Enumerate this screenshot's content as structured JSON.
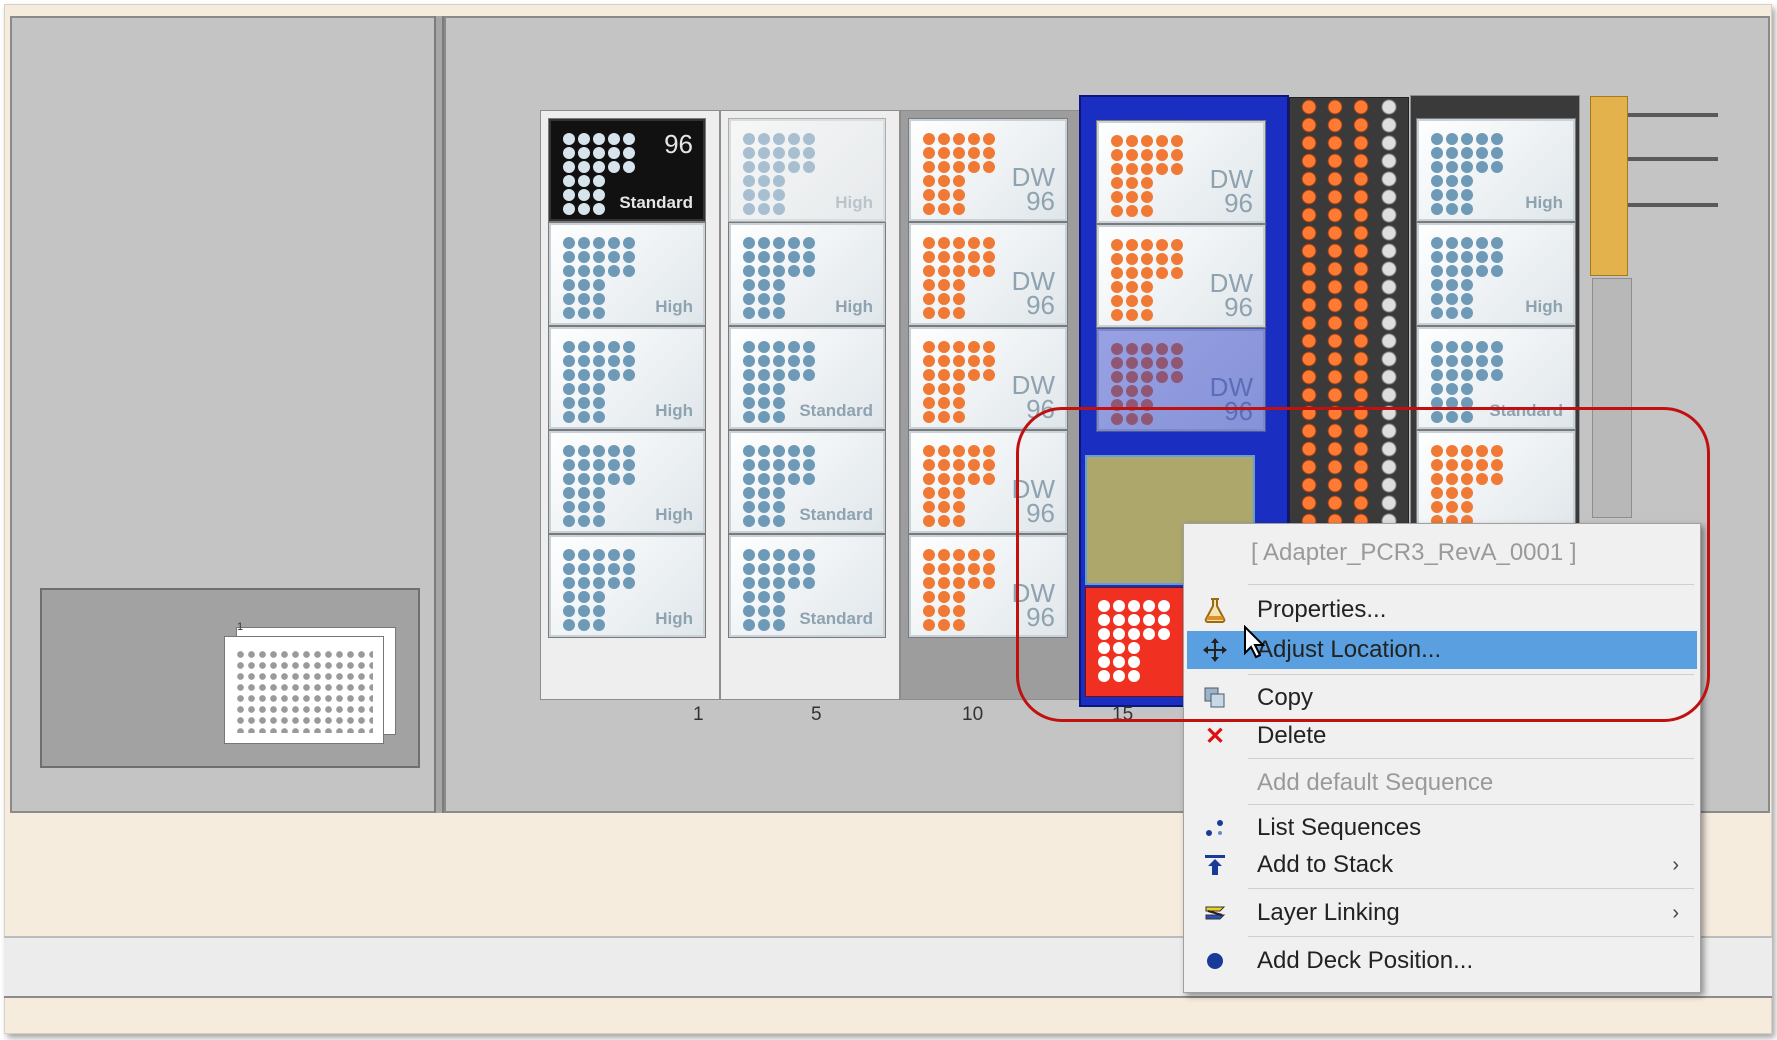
{
  "menu": {
    "title": "[ Adapter_PCR3_RevA_0001 ]",
    "items": [
      {
        "label": "Properties...",
        "icon": "flask-icon",
        "state": "normal"
      },
      {
        "label": "Adjust Location...",
        "icon": "move-arrows-icon",
        "state": "highlighted"
      },
      {
        "label": "Copy",
        "icon": "copy-icon",
        "state": "normal"
      },
      {
        "label": "Delete",
        "icon": "red-x-icon",
        "state": "normal"
      },
      {
        "label": "Add default Sequence",
        "icon": "",
        "state": "disabled"
      },
      {
        "label": "List Sequences",
        "icon": "sequence-dots-icon",
        "state": "normal"
      },
      {
        "label": "Add to Stack",
        "icon": "stack-up-icon",
        "state": "normal",
        "submenu": true
      },
      {
        "label": "Layer Linking",
        "icon": "layer-link-icon",
        "state": "normal",
        "submenu": true
      },
      {
        "label": "Add Deck Position...",
        "icon": "blue-dot-icon",
        "state": "normal"
      }
    ],
    "submenu_arrow": "›"
  },
  "deck": {
    "track_numbers": [
      "1",
      "5",
      "10",
      "15"
    ],
    "stack_number": "1",
    "plates_col1": [
      {
        "label": "Standard",
        "num": "96",
        "style": "black"
      },
      {
        "label": "High"
      },
      {
        "label": "High"
      },
      {
        "label": "High"
      },
      {
        "label": "High"
      }
    ],
    "plates_col2": [
      {
        "label": "High",
        "faint": true
      },
      {
        "label": "High"
      },
      {
        "label": "Standard"
      },
      {
        "label": "Standard"
      },
      {
        "label": "Standard"
      }
    ],
    "plates_col3": [
      {
        "label": "DW 96"
      },
      {
        "label": "DW 96"
      },
      {
        "label": "DW 96"
      },
      {
        "label": "DW 96"
      },
      {
        "label": "DW 96"
      }
    ],
    "plates_col4": [
      {
        "label": "DW 96"
      },
      {
        "label": "DW 96"
      },
      {
        "label": "DW 96",
        "faint": true
      }
    ],
    "plates_col6": [
      {
        "label": "High"
      },
      {
        "label": "High"
      },
      {
        "label": "Standard"
      },
      {
        "label": ""
      }
    ]
  },
  "colors": {
    "highlight": "#5aa0e0",
    "ring": "#c01010",
    "blue_carrier": "#1a2ec2",
    "dot_blue": "#6e9ab8",
    "dot_orange": "#f07a35"
  }
}
